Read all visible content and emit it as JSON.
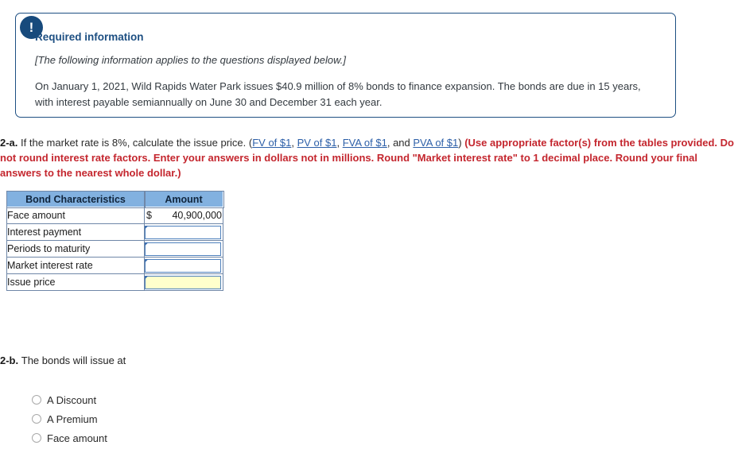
{
  "callout": {
    "icon": "exclamation-icon",
    "badge_glyph": "!",
    "title": "Required information",
    "italic_note": "[The following information applies to the questions displayed below.]",
    "body": "On January 1, 2021, Wild Rapids Water Park issues $40.9 million of 8% bonds to finance expansion.  The bonds are due in 15 years, with interest payable semiannually on June 30 and December 31 each year.",
    "border_color": "#1d4f82",
    "badge_color": "#174a7c"
  },
  "question_2a": {
    "label": "2-a.",
    "text_before": "If the market rate is 8%, calculate the issue price. (",
    "links": [
      {
        "text": "FV of $1",
        "separator": ", "
      },
      {
        "text": "PV of $1",
        "separator": ", "
      },
      {
        "text": "FVA of $1",
        "separator": ", and "
      },
      {
        "text": "PVA of $1",
        "separator": ")"
      }
    ],
    "instruction": "(Use appropriate factor(s) from the tables provided. Do not round interest rate factors. Enter your answers in dollars not in millions. Round \"Market interest rate\" to 1 decimal place. Round your final answers to the nearest whole dollar.)",
    "link_color": "#2c5fa8",
    "instruction_color": "#c4262e"
  },
  "table": {
    "headers": [
      "Bond Characteristics",
      "Amount"
    ],
    "header_bg": "#82b1e0",
    "rows": [
      {
        "label": "Face amount",
        "type": "value",
        "currency": "$",
        "value": "40,900,000"
      },
      {
        "label": "Interest payment",
        "type": "input",
        "value": "",
        "highlight": false
      },
      {
        "label": "Periods to maturity",
        "type": "input",
        "value": "",
        "highlight": false
      },
      {
        "label": "Market interest rate",
        "type": "input",
        "value": "",
        "highlight": false
      },
      {
        "label": "Issue price",
        "type": "input",
        "value": "",
        "highlight": true
      }
    ],
    "highlight_color": "#ffffcc",
    "input_border_color": "#4f81bd"
  },
  "question_2b": {
    "label": "2-b.",
    "text": "The bonds will issue at",
    "options": [
      {
        "label": "A Discount",
        "selected": false
      },
      {
        "label": "A Premium",
        "selected": false
      },
      {
        "label": "Face amount",
        "selected": false
      }
    ]
  }
}
